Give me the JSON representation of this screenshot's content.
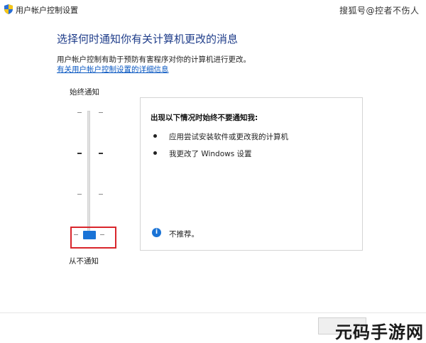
{
  "window": {
    "title": "用户帐户控制设置",
    "icon": "shield-icon"
  },
  "watermark_top": "搜狐号@控者不伤人",
  "heading": "选择何时通知你有关计算机更改的消息",
  "description": "用户帐户控制有助于预防有害程序对你的计算机进行更改。",
  "link_text": "有关用户帐户控制设置的详细信息",
  "slider": {
    "top_label": "始终通知",
    "bottom_label": "从不通知",
    "levels": 4,
    "selected_level": 1,
    "selected_level_description": "lowest (never notify)"
  },
  "panel": {
    "heading": "出现以下情况时始终不要通知我:",
    "bullets": [
      "应用尝试安装软件或更改我的计算机",
      "我更改了 Windows 设置"
    ],
    "info_icon": "info-icon",
    "info_text": "不推荐。"
  },
  "brand_watermark": "元码手游网",
  "colors": {
    "heading": "#1f3d8a",
    "link": "#0a58c2",
    "thumb": "#1a73d6",
    "highlight_box": "#d9262c"
  }
}
